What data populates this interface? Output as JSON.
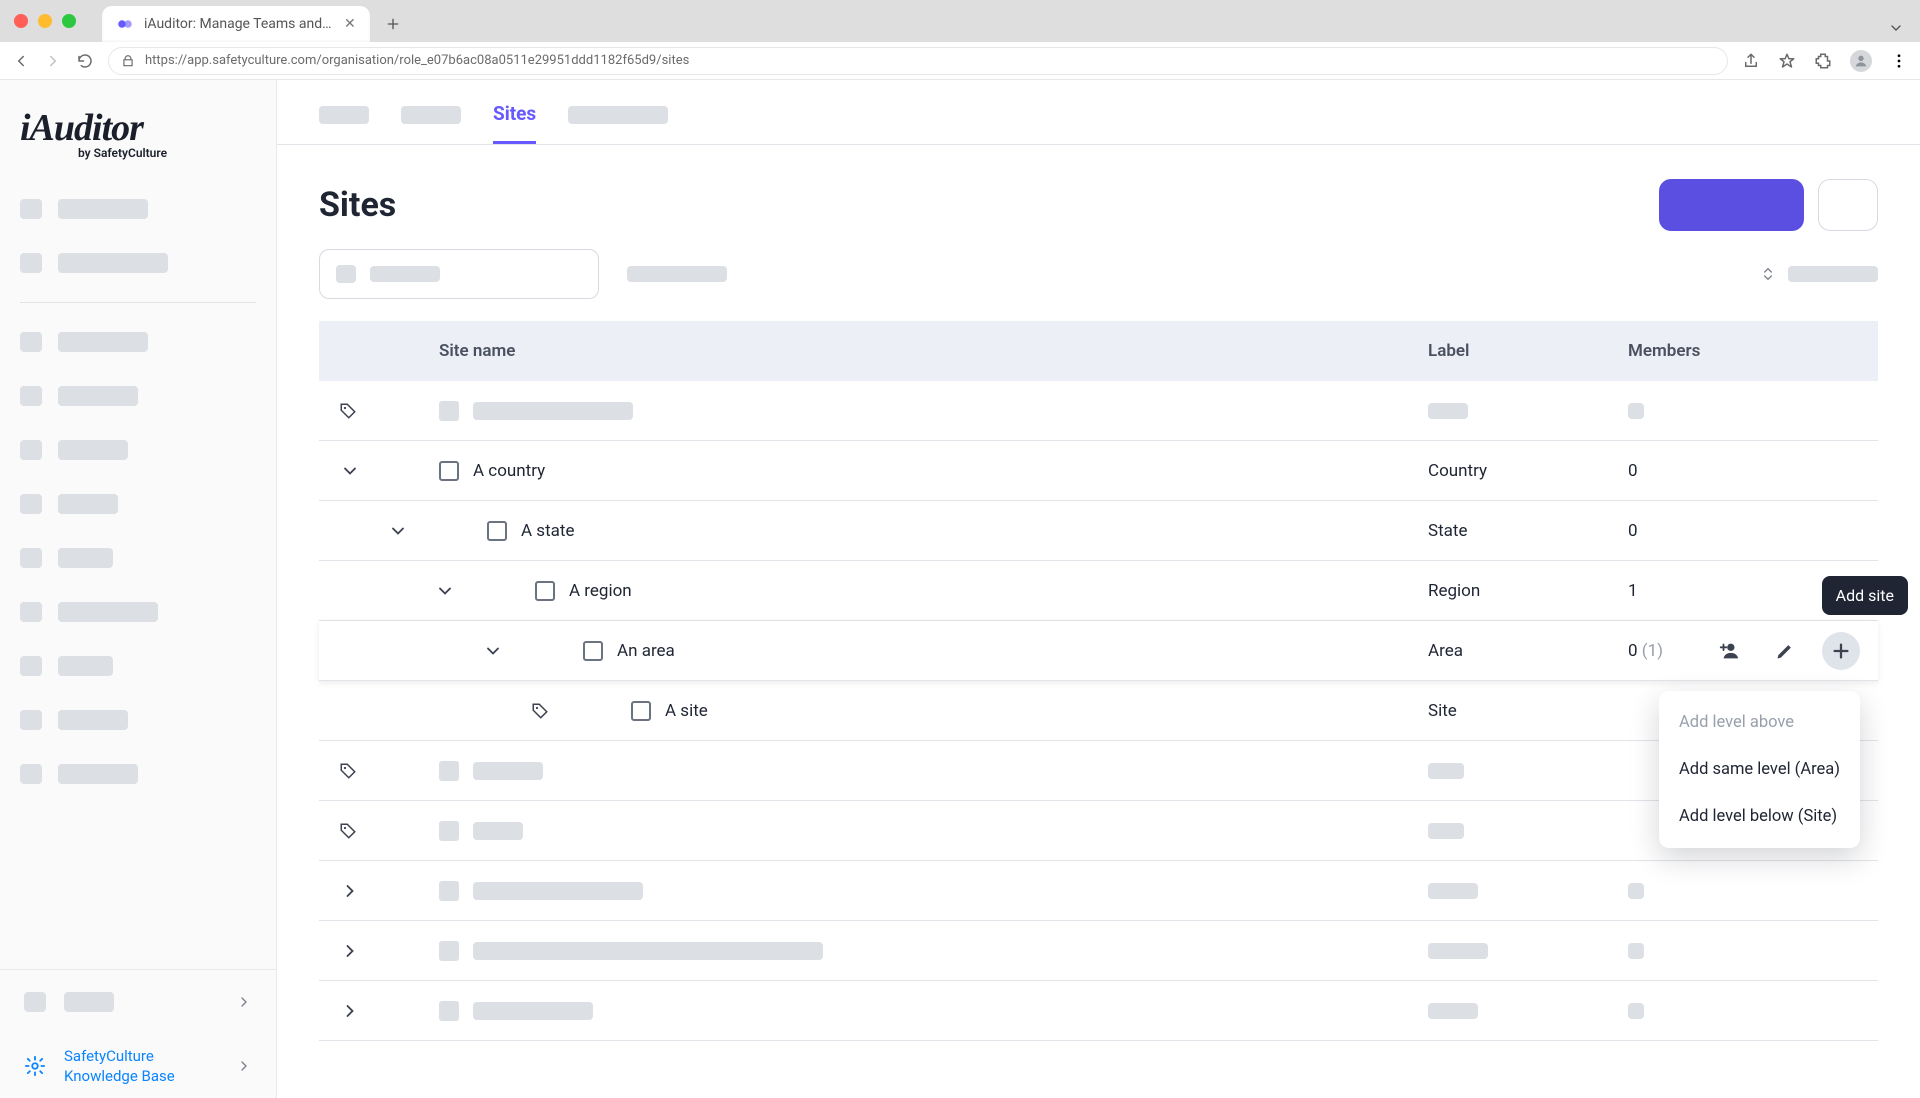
{
  "browser": {
    "tab_title": "iAuditor: Manage Teams and In",
    "url": "https://app.safetyculture.com/organisation/role_e07b6ac08a0511e29951ddd1182f65d9/sites"
  },
  "brand": {
    "name": "iAuditor",
    "byline": "by SafetyCulture"
  },
  "sidebar_footer": {
    "kb_line1": "SafetyCulture",
    "kb_line2": "Knowledge Base"
  },
  "tabs": {
    "active": "Sites"
  },
  "page": {
    "title": "Sites"
  },
  "columns": {
    "name": "Site name",
    "label": "Label",
    "members": "Members"
  },
  "rows": {
    "country": {
      "name": "A country",
      "label": "Country",
      "members": "0"
    },
    "state": {
      "name": "A state",
      "label": "State",
      "members": "0"
    },
    "region": {
      "name": "A region",
      "label": "Region",
      "members": "1"
    },
    "area": {
      "name": "An area",
      "label": "Area",
      "members": "0",
      "members_inherited": "(1)"
    },
    "site": {
      "name": "A site",
      "label": "Site"
    }
  },
  "tooltip": {
    "add_site": "Add site"
  },
  "menu": {
    "above": "Add level above",
    "same": "Add same level (Area)",
    "below": "Add level below (Site)"
  }
}
